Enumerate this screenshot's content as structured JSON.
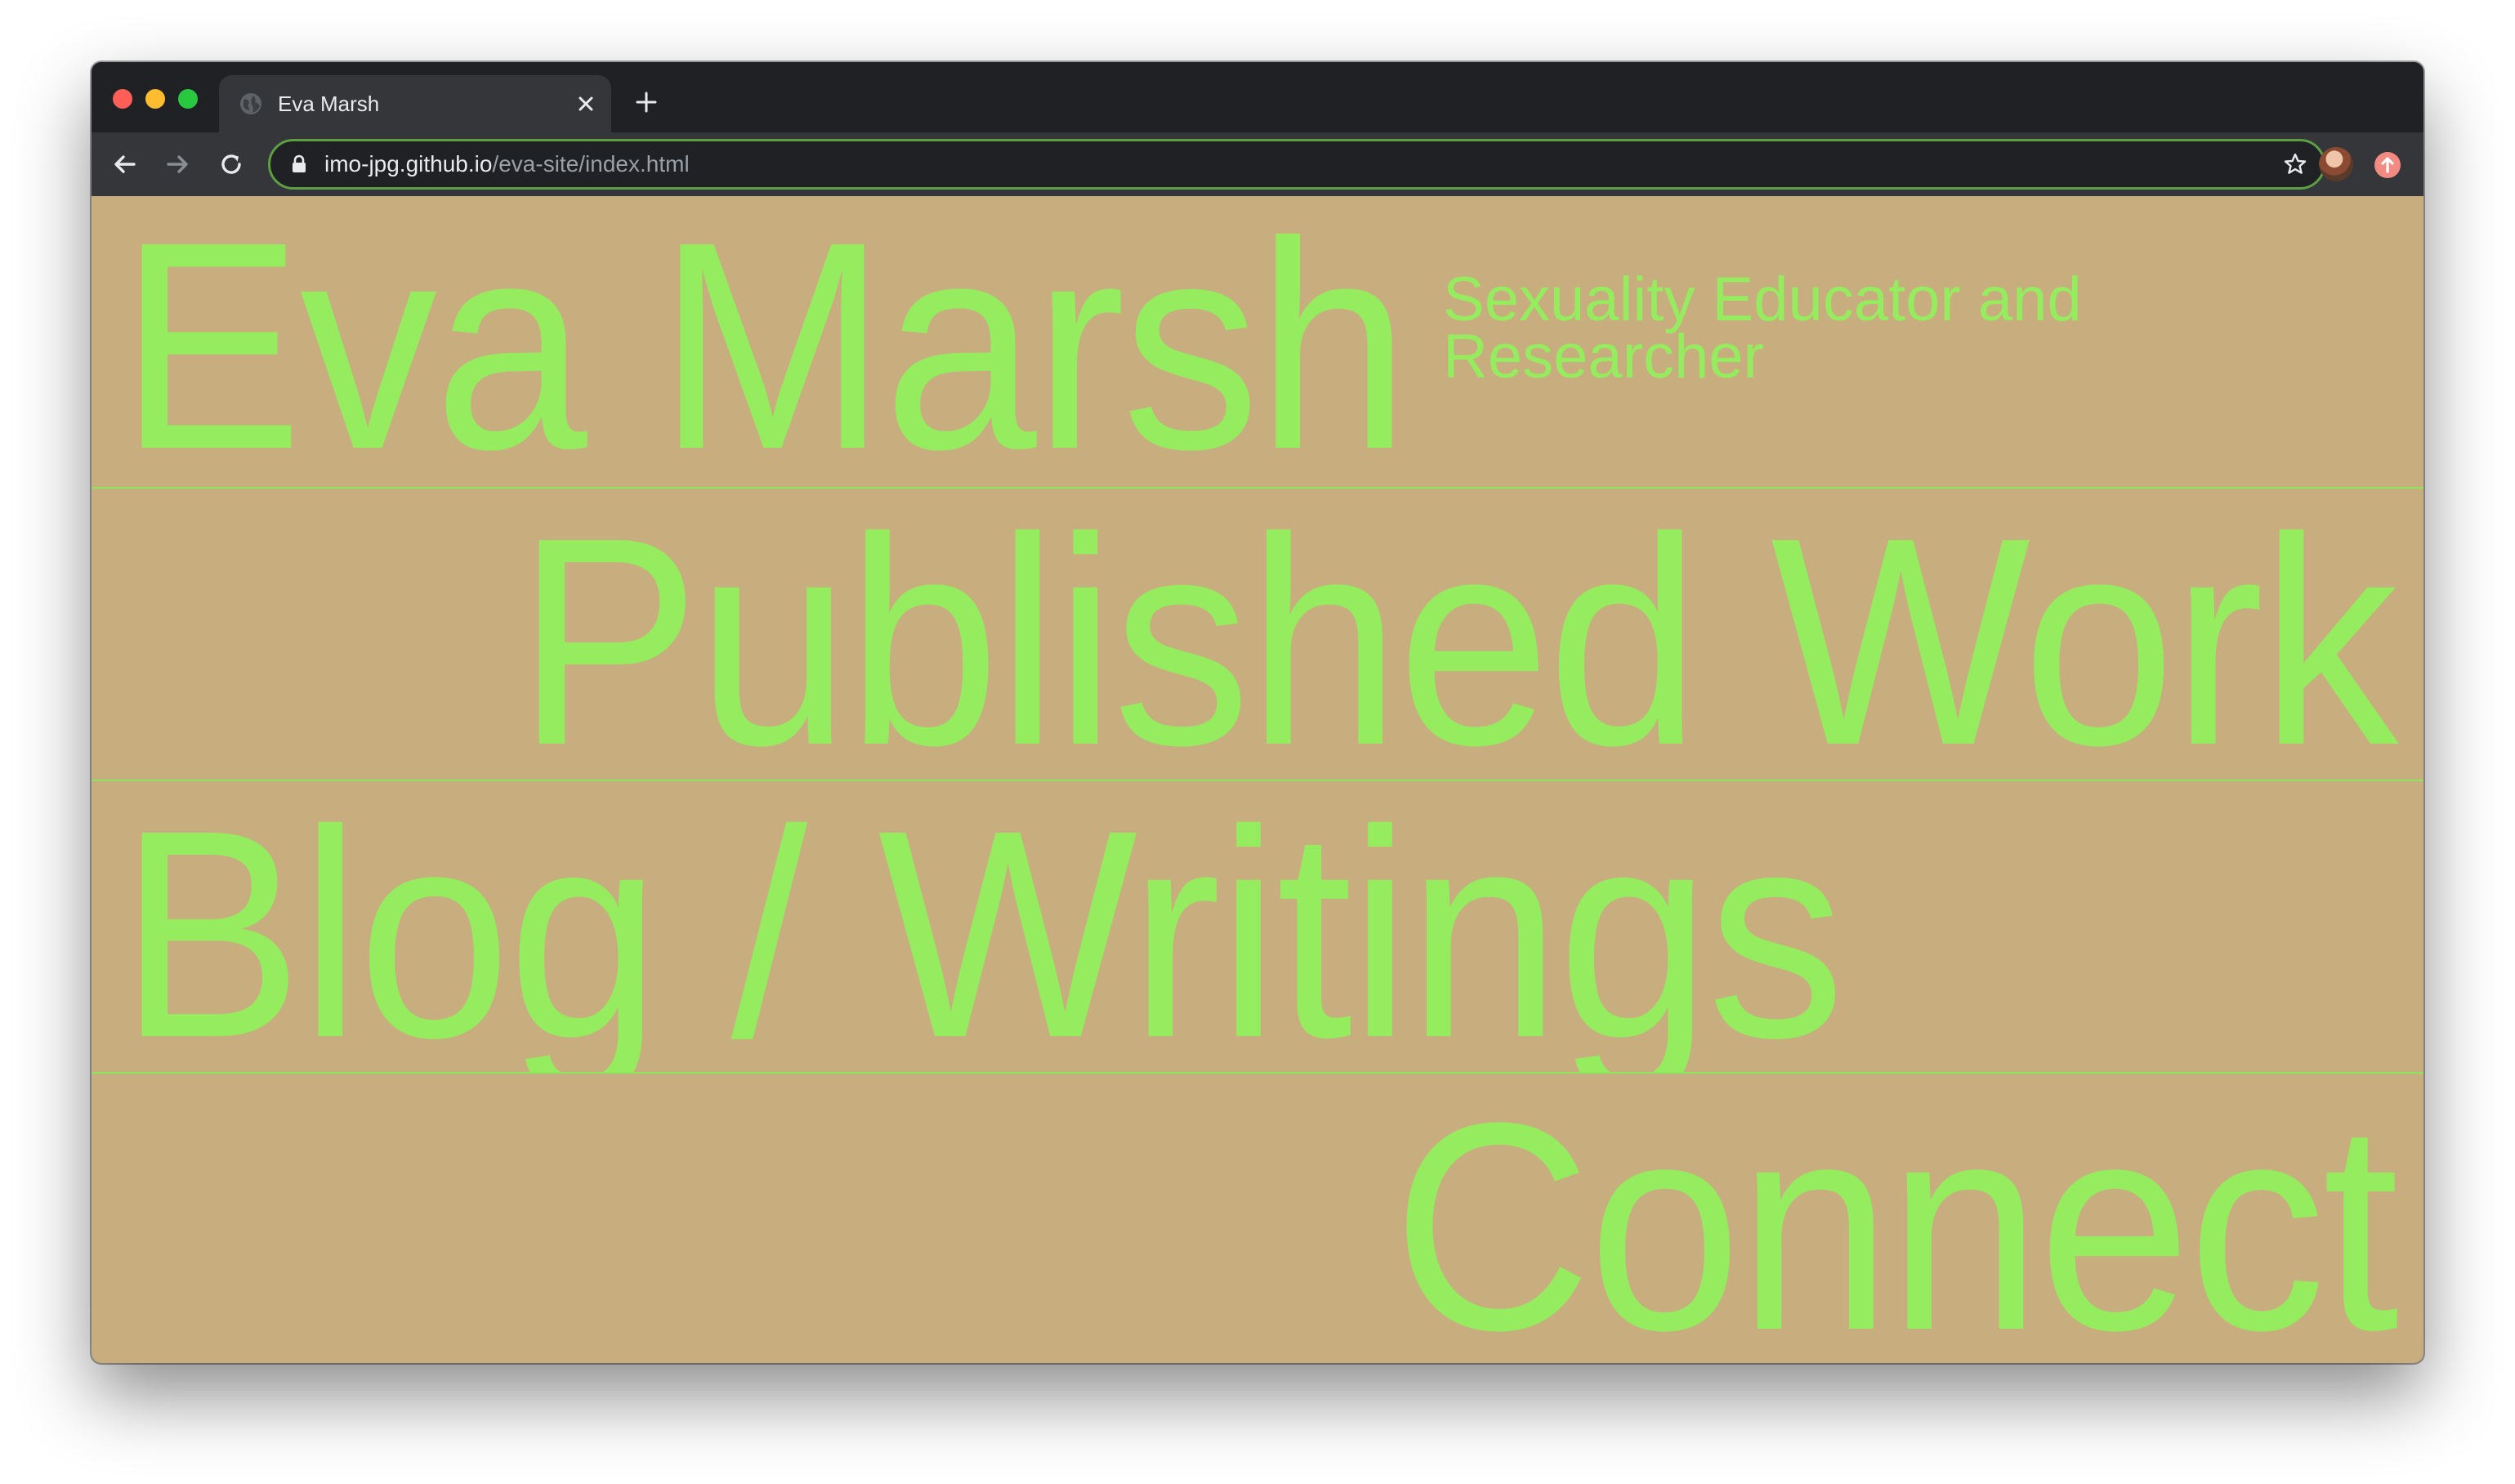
{
  "browser": {
    "tab": {
      "title": "Eva Marsh",
      "favicon": "globe-icon"
    },
    "address_bar": {
      "host": "imo-jpg.github.io",
      "path": "/eva-site/index.html"
    },
    "icons": {
      "back": "back-arrow-icon",
      "forward": "forward-arrow-icon",
      "reload": "reload-icon",
      "lock": "lock-icon",
      "bookmark": "star-icon",
      "close_tab": "close-icon",
      "new_tab": "plus-icon",
      "profile": "avatar",
      "update": "update-icon"
    }
  },
  "page": {
    "name": "Eva Marsh",
    "subtitle": "Sexuality Educator and Researcher",
    "nav": [
      {
        "label": "Published Work"
      },
      {
        "label": "Blog / Writings"
      },
      {
        "label": "Connect"
      }
    ]
  },
  "colors": {
    "page_background": "#c8ae7e",
    "accent_green": "#94ec5e",
    "browser_frame": "#202124",
    "toolbar": "#35363a"
  }
}
